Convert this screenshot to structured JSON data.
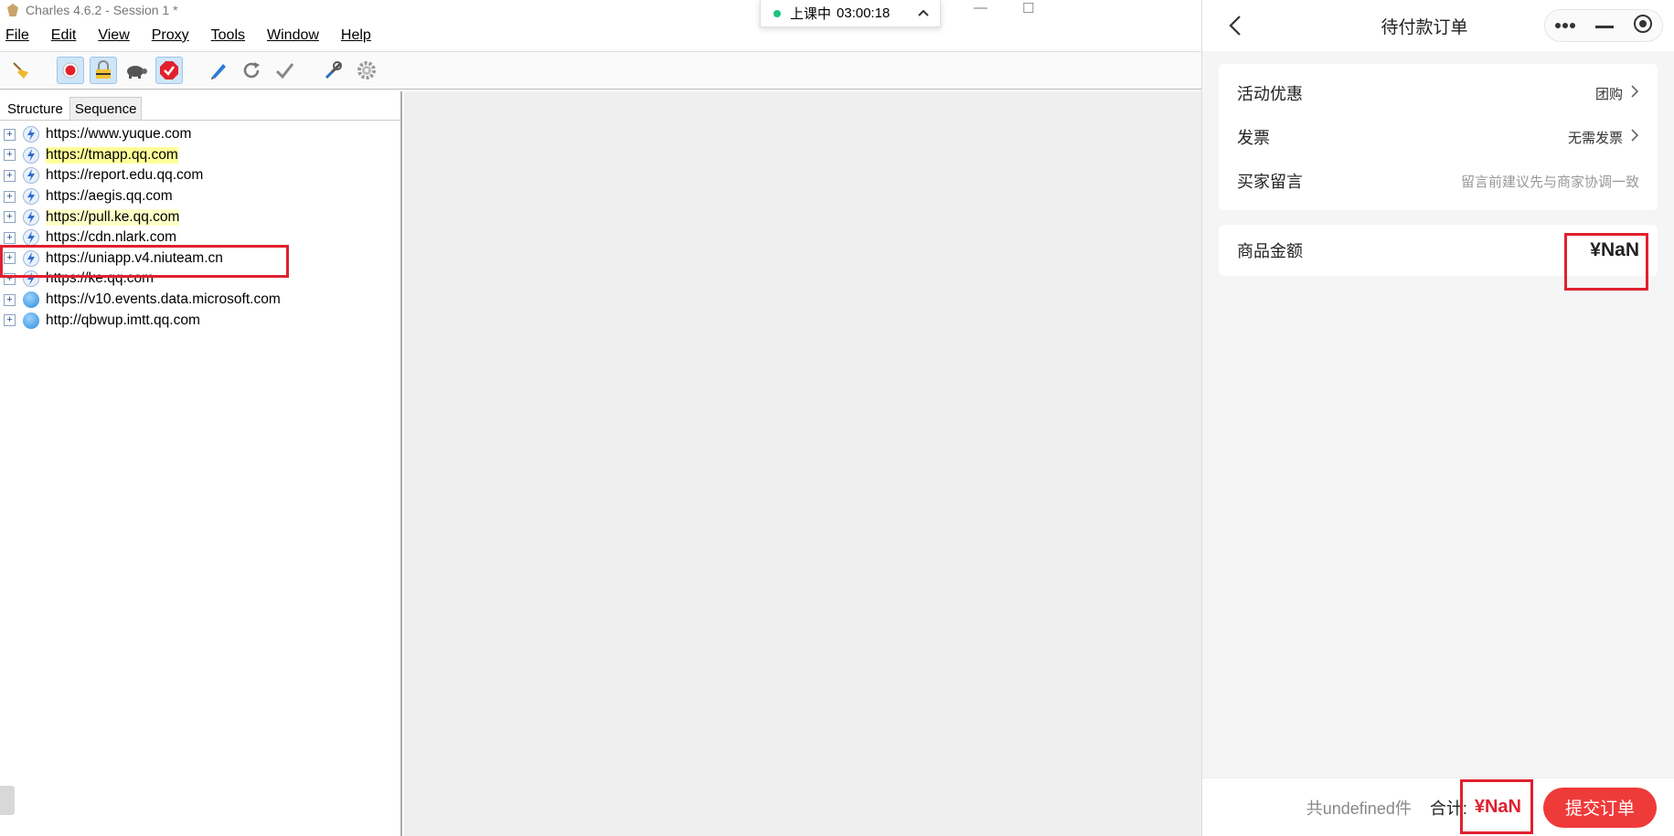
{
  "window": {
    "title": "Charles 4.6.2 - Session 1 *"
  },
  "menu": [
    "File",
    "Edit",
    "View",
    "Proxy",
    "Tools",
    "Window",
    "Help"
  ],
  "toolbar": {
    "icons": [
      "broom-icon",
      "record-icon",
      "ssl-lock-icon",
      "throttle-turtle-icon",
      "breakpoint-icon",
      "compose-pen-icon",
      "repeat-icon",
      "validate-check-icon",
      "tools-icon",
      "settings-gear-icon"
    ]
  },
  "tabs": {
    "structure": "Structure",
    "sequence": "Sequence"
  },
  "hosts": [
    {
      "url": "https://www.yuque.com",
      "icon": "bolt",
      "hl": ""
    },
    {
      "url": "https://tmapp.qq.com",
      "icon": "bolt",
      "hl": "hl"
    },
    {
      "url": "https://report.edu.qq.com",
      "icon": "bolt",
      "hl": ""
    },
    {
      "url": "https://aegis.qq.com",
      "icon": "bolt",
      "hl": ""
    },
    {
      "url": "https://pull.ke.qq.com",
      "icon": "bolt",
      "hl": "hl2"
    },
    {
      "url": "https://cdn.nlark.com",
      "icon": "bolt",
      "hl": ""
    },
    {
      "url": "https://uniapp.v4.niuteam.cn",
      "icon": "bolt",
      "hl": ""
    },
    {
      "url": "https://ke.qq.com",
      "icon": "bolt",
      "hl": ""
    },
    {
      "url": "https://v10.events.data.microsoft.com",
      "icon": "globe",
      "hl": ""
    },
    {
      "url": "http://qbwup.imtt.qq.com",
      "icon": "globe",
      "hl": ""
    }
  ],
  "timer": {
    "status": "上课中",
    "time": "03:00:18"
  },
  "mini_program": {
    "title": "待付款订单",
    "rows": [
      {
        "label": "活动优惠",
        "value": "团购"
      },
      {
        "label": "发票",
        "value": "无需发票"
      },
      {
        "label": "买家留言",
        "placeholder": "留言前建议先与商家协调一致"
      }
    ],
    "goods_amount_label": "商品金额",
    "goods_amount": "¥NaN",
    "count_text": "共undefined件",
    "total_label": "合计:",
    "total": "¥NaN",
    "submit_label": "提交订单"
  },
  "colors": {
    "accent_red": "#ef3a3a",
    "annotation_red": "#e0202e",
    "highlight_yellow": "#ffff99"
  }
}
